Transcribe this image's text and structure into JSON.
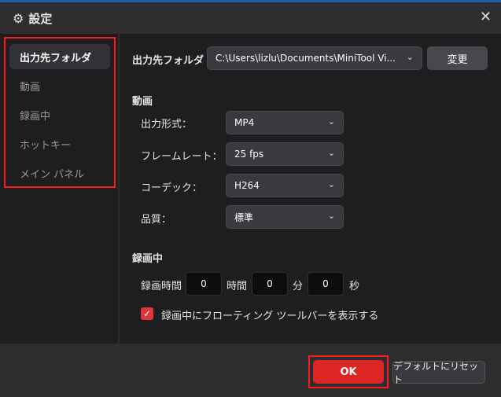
{
  "title": "設定",
  "sidebar": {
    "items": [
      {
        "label": "出力先フォルダ"
      },
      {
        "label": "動画"
      },
      {
        "label": "録画中"
      },
      {
        "label": "ホットキー"
      },
      {
        "label": "メイン パネル"
      }
    ]
  },
  "output": {
    "label": "出力先フォルダ",
    "path": "C:\\Users\\lizlu\\Documents\\MiniTool Vi...",
    "change": "変更"
  },
  "video": {
    "heading": "動画",
    "format_label": "出力形式：",
    "format": "MP4",
    "fps_label": "フレームレート：",
    "fps": "25 fps",
    "codec_label": "コーデック：",
    "codec": "H264",
    "quality_label": "品質：",
    "quality": "標準"
  },
  "recording": {
    "heading": "録画中",
    "duration_label": "録画時間",
    "hours": "0",
    "hours_unit": "時間",
    "minutes": "0",
    "minutes_unit": "分",
    "seconds": "0",
    "seconds_unit": "秒",
    "floating_toolbar_label": "録画中にフローティング ツールバーを表示する",
    "floating_toolbar_checked": true
  },
  "footer": {
    "ok": "OK",
    "reset": "デフォルトにリセット"
  }
}
